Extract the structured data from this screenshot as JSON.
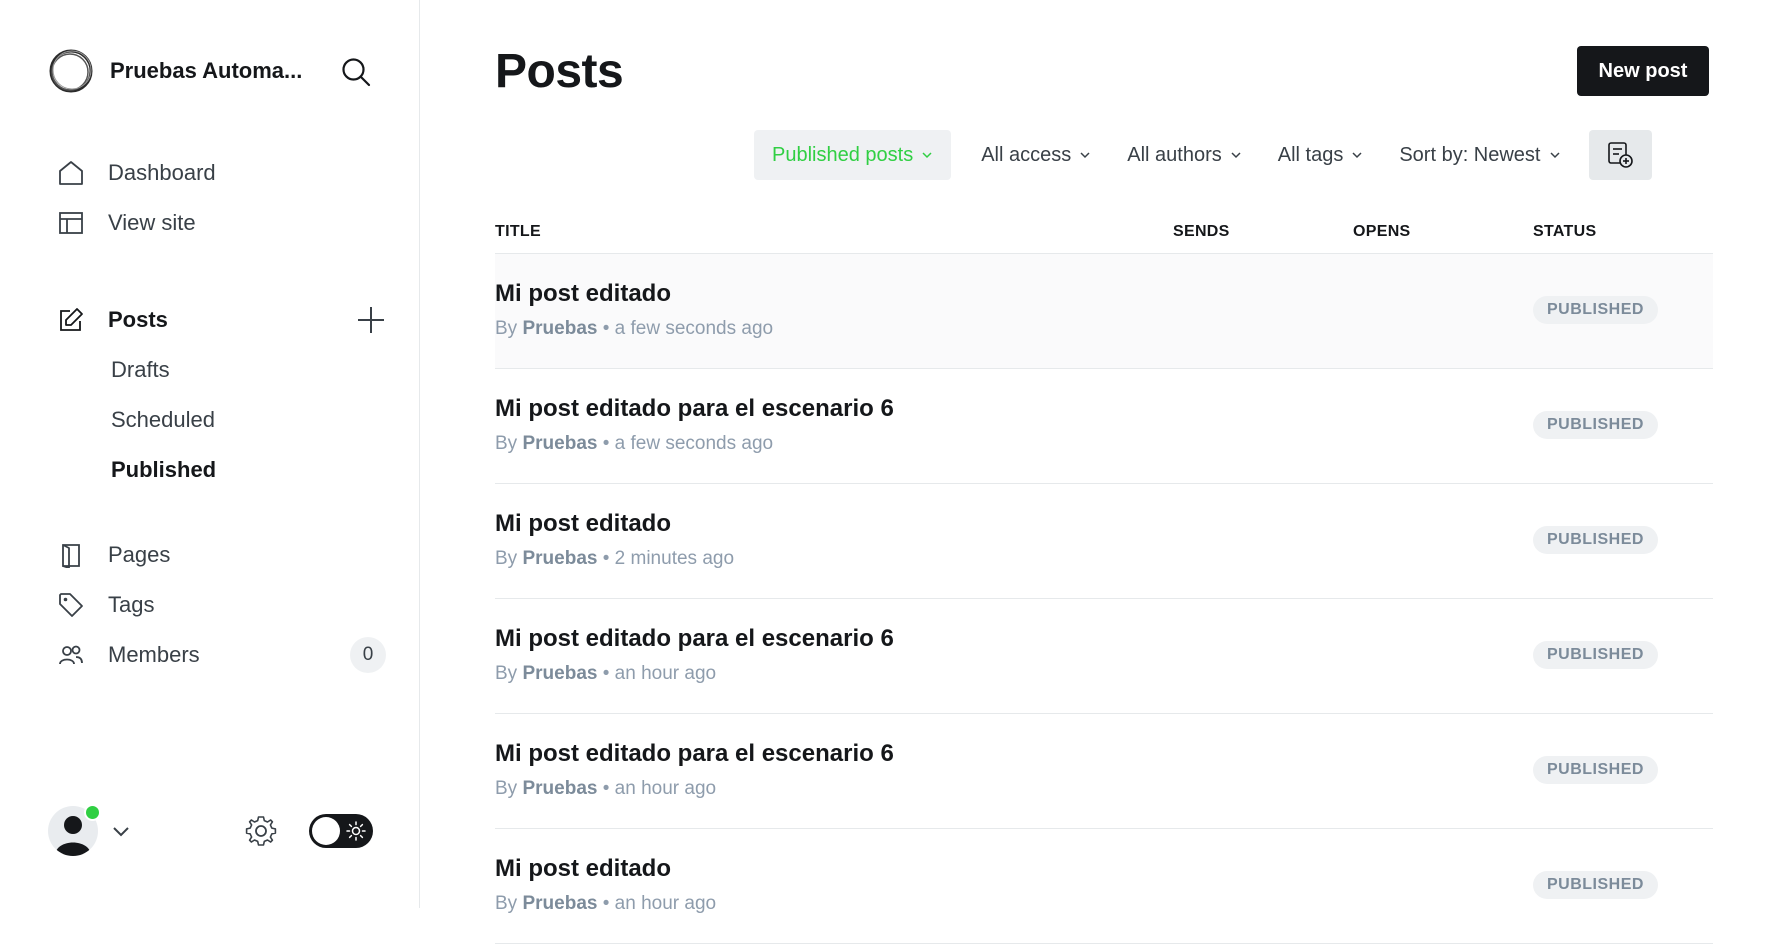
{
  "brand": {
    "name": "Pruebas Automa..."
  },
  "nav": {
    "dashboard": "Dashboard",
    "view_site": "View site",
    "posts": "Posts",
    "sub": {
      "drafts": "Drafts",
      "scheduled": "Scheduled",
      "published": "Published"
    },
    "pages": "Pages",
    "tags": "Tags",
    "members": "Members",
    "members_count": "0"
  },
  "header": {
    "title": "Posts",
    "new_post_label": "New post"
  },
  "filters": {
    "type": "Published posts",
    "access": "All access",
    "authors": "All authors",
    "tags": "All tags",
    "sort": "Sort by: Newest"
  },
  "table": {
    "columns": {
      "title": "TITLE",
      "sends": "SENDS",
      "opens": "OPENS",
      "status": "STATUS"
    },
    "rows": [
      {
        "title": "Mi post editado",
        "by": "By",
        "author": "Pruebas",
        "time": "• a few seconds ago",
        "status": "PUBLISHED"
      },
      {
        "title": "Mi post editado para el escenario 6",
        "by": "By",
        "author": "Pruebas",
        "time": "• a few seconds ago",
        "status": "PUBLISHED"
      },
      {
        "title": "Mi post editado",
        "by": "By",
        "author": "Pruebas",
        "time": "• 2 minutes ago",
        "status": "PUBLISHED"
      },
      {
        "title": "Mi post editado para el escenario 6",
        "by": "By",
        "author": "Pruebas",
        "time": "• an hour ago",
        "status": "PUBLISHED"
      },
      {
        "title": "Mi post editado para el escenario 6",
        "by": "By",
        "author": "Pruebas",
        "time": "• an hour ago",
        "status": "PUBLISHED"
      },
      {
        "title": "Mi post editado",
        "by": "By",
        "author": "Pruebas",
        "time": "• an hour ago",
        "status": "PUBLISHED"
      }
    ]
  },
  "colors": {
    "accent_green": "#30cf43",
    "dark": "#15171a",
    "muted": "#8e9cac",
    "badge_bg": "#eff1f3"
  },
  "icons": [
    "logo-icon",
    "search-icon",
    "home-icon",
    "layout-icon",
    "edit-icon",
    "plus-icon",
    "book-icon",
    "tag-icon",
    "members-icon",
    "avatar-icon",
    "chevron-down-icon",
    "gear-icon",
    "sun-icon",
    "filter-settings-icon"
  ]
}
